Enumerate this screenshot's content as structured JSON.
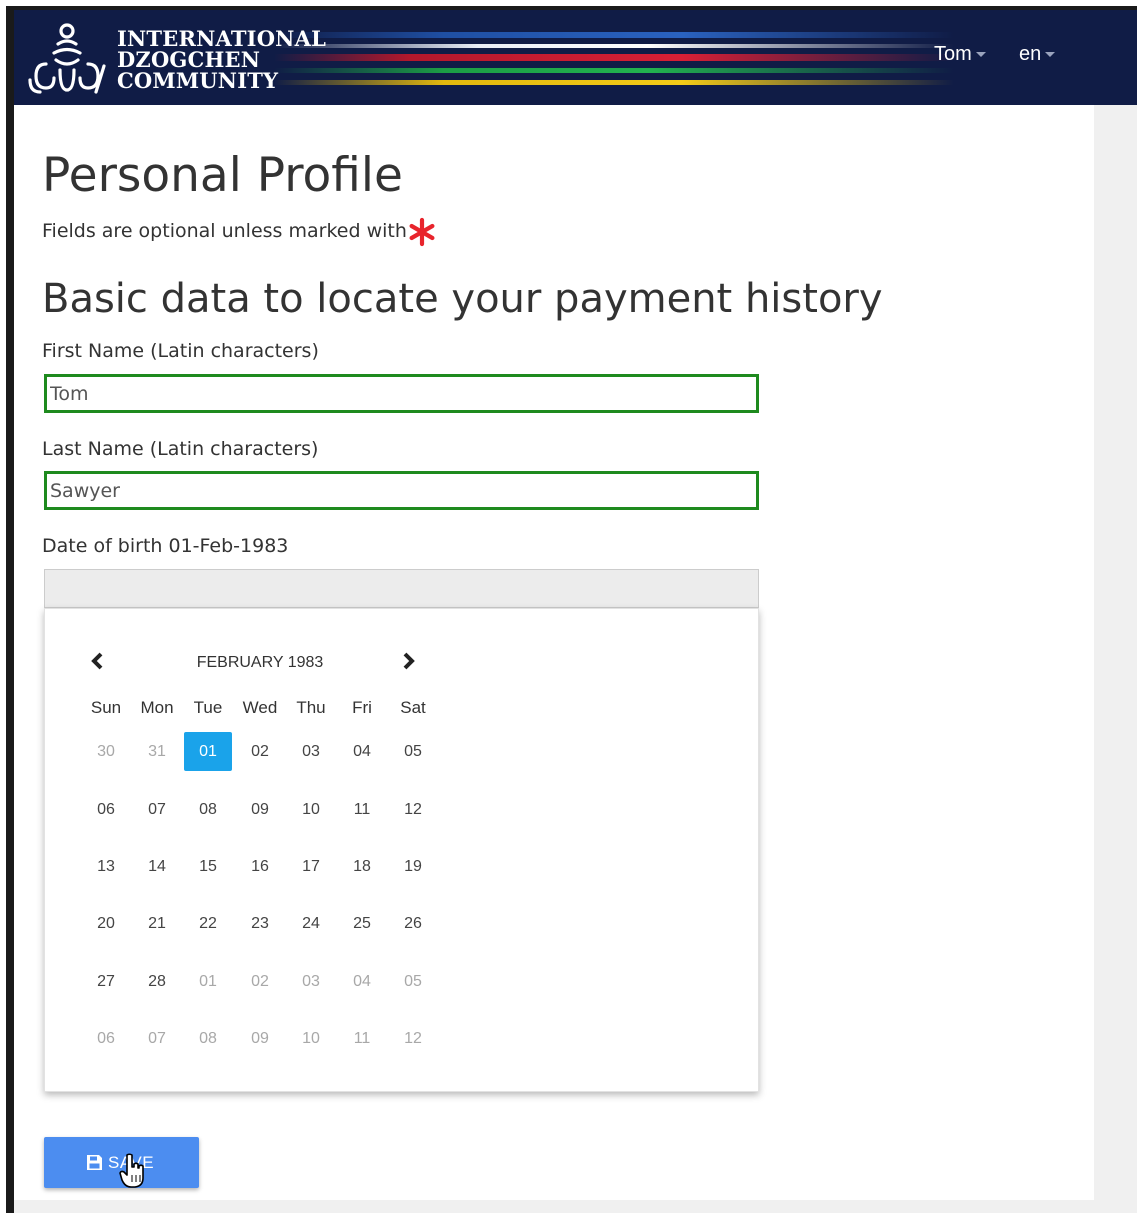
{
  "header": {
    "logo_lines": [
      "INTERNATIONAL",
      "DZOGCHEN",
      "COMMUNITY"
    ],
    "user_menu": "Tom",
    "language_menu": "en"
  },
  "main": {
    "title": "Personal Profile",
    "hint": "Fields are optional unless marked with",
    "section_title": "Basic data to locate your payment history",
    "first_name": {
      "label": "First Name (Latin characters)",
      "value": "Tom"
    },
    "last_name": {
      "label": "Last Name (Latin characters)",
      "value": "Sawyer"
    },
    "dob": {
      "label": "Date of birth 01-Feb-1983",
      "value": ""
    }
  },
  "datepicker": {
    "month_label": "FEBRUARY 1983",
    "weekdays": [
      "Sun",
      "Mon",
      "Tue",
      "Wed",
      "Thu",
      "Fri",
      "Sat"
    ],
    "weeks": [
      [
        "30",
        "31",
        "01",
        "02",
        "03",
        "04",
        "05"
      ],
      [
        "06",
        "07",
        "08",
        "09",
        "10",
        "11",
        "12"
      ],
      [
        "13",
        "14",
        "15",
        "16",
        "17",
        "18",
        "19"
      ],
      [
        "20",
        "21",
        "22",
        "23",
        "24",
        "25",
        "26"
      ],
      [
        "27",
        "28",
        "01",
        "02",
        "03",
        "04",
        "05"
      ],
      [
        "06",
        "07",
        "08",
        "09",
        "10",
        "11",
        "12"
      ]
    ],
    "selected": "01",
    "leading_other_month_days": 2,
    "current_month_days": 28
  },
  "actions": {
    "save_label": "SAVE"
  },
  "colors": {
    "header_bg": "#101c46",
    "valid_border": "#1e8a1e",
    "selected_day": "#1aa3ea",
    "save_button": "#4c8df0",
    "required_star": "#e8242c"
  },
  "icons": {
    "logo": "dzogchen-logo-icon",
    "required": "asterisk-icon",
    "prev": "chevron-left-icon",
    "next": "chevron-right-icon",
    "save": "floppy-disk-icon",
    "cursor": "hand-cursor-icon"
  }
}
